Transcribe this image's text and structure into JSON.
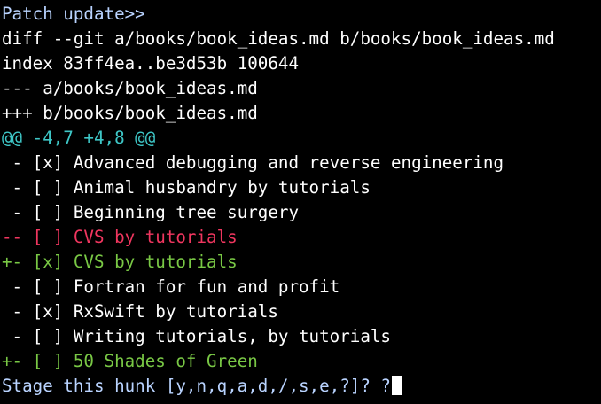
{
  "colors": {
    "background": "#000000",
    "default": "#ffffff",
    "prompt": "#b9d3ff",
    "hunk_header": "#3ec7c7",
    "removed": "#f0365f",
    "added": "#79c845",
    "cursor": "#ffffff"
  },
  "terminal": {
    "lines": [
      {
        "text": "Patch update>>",
        "role": "prompt"
      },
      {
        "text": "diff --git a/books/book_ideas.md b/books/book_ideas.md",
        "role": "default"
      },
      {
        "text": "index 83ff4ea..be3d53b 100644",
        "role": "default"
      },
      {
        "text": "--- a/books/book_ideas.md",
        "role": "default"
      },
      {
        "text": "+++ b/books/book_ideas.md",
        "role": "default"
      },
      {
        "text": "@@ -4,7 +4,8 @@",
        "role": "hunk_header"
      },
      {
        "text": " - [x] Advanced debugging and reverse engineering",
        "role": "default"
      },
      {
        "text": " - [ ] Animal husbandry by tutorials",
        "role": "default"
      },
      {
        "text": " - [ ] Beginning tree surgery",
        "role": "default"
      },
      {
        "text": "-- [ ] CVS by tutorials",
        "role": "removed"
      },
      {
        "text": "+- [x] CVS by tutorials",
        "role": "added"
      },
      {
        "text": " - [ ] Fortran for fun and profit",
        "role": "default"
      },
      {
        "text": " - [x] RxSwift by tutorials",
        "role": "default"
      },
      {
        "text": " - [ ] Writing tutorials, by tutorials",
        "role": "default"
      },
      {
        "text": "+- [ ] 50 Shades of Green",
        "role": "added"
      }
    ],
    "input_prompt": {
      "text": "Stage this hunk [y,n,q,a,d,/,s,e,?]? ",
      "typed": "?",
      "role": "prompt"
    }
  }
}
